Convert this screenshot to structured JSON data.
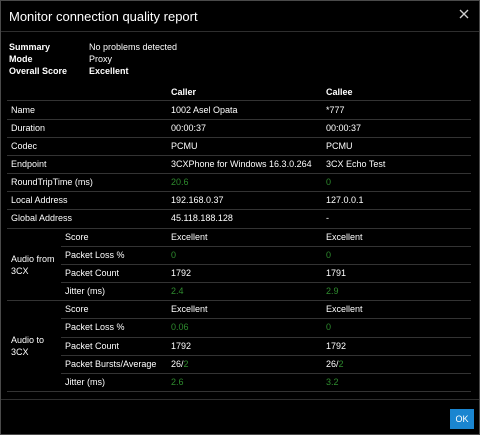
{
  "dialog": {
    "title": "Monitor connection quality report",
    "ok_label": "OK"
  },
  "summary": [
    {
      "label": "Summary",
      "value": "No problems detected"
    },
    {
      "label": "Mode",
      "value": "Proxy"
    },
    {
      "label": "Overall Score",
      "value": "Excellent"
    }
  ],
  "columns": {
    "caller": "Caller",
    "callee": "Callee"
  },
  "rows": [
    {
      "label": "Name",
      "caller": "1002 Asel Opata",
      "callee": "*777"
    },
    {
      "label": "Duration",
      "caller": "00:00:37",
      "callee": "00:00:37"
    },
    {
      "label": "Codec",
      "caller": "PCMU",
      "callee": "PCMU"
    },
    {
      "label": "Endpoint",
      "caller": "3CXPhone for Windows 16.3.0.264",
      "callee": "3CX Echo Test"
    },
    {
      "label": "RoundTripTime (ms)",
      "caller": "20.6",
      "callee": "0"
    },
    {
      "label": "Local Address",
      "caller": "192.168.0.37",
      "callee": "127.0.0.1"
    },
    {
      "label": "Global Address",
      "caller": "45.118.188.128",
      "callee": "-"
    }
  ],
  "audio_from": {
    "label_line1": "Audio from",
    "label_line2": "3CX",
    "rows": [
      {
        "label": "Score",
        "caller": "Excellent",
        "callee": "Excellent"
      },
      {
        "label": "Packet Loss %",
        "caller": "0",
        "callee": "0"
      },
      {
        "label": "Packet Count",
        "caller": "1792",
        "callee": "1791"
      },
      {
        "label": "Jitter (ms)",
        "caller": "2.4",
        "callee": "2.9"
      }
    ]
  },
  "audio_to": {
    "label_line1": "Audio to",
    "label_line2": "3CX",
    "rows": [
      {
        "label": "Score",
        "caller": "Excellent",
        "callee": "Excellent"
      },
      {
        "label": "Packet Loss %",
        "caller": "0.06",
        "callee": "0"
      },
      {
        "label": "Packet Count",
        "caller": "1792",
        "callee": "1792"
      },
      {
        "label": "Packet Bursts/Average",
        "caller_a": "26/",
        "caller_b": "2",
        "callee_a": "26/",
        "callee_b": "2"
      },
      {
        "label": "Jitter (ms)",
        "caller": "2.6",
        "callee": "3.2"
      }
    ]
  },
  "colors": {
    "green_value": "#2e8b2e",
    "ok_button": "#1a85d0"
  }
}
